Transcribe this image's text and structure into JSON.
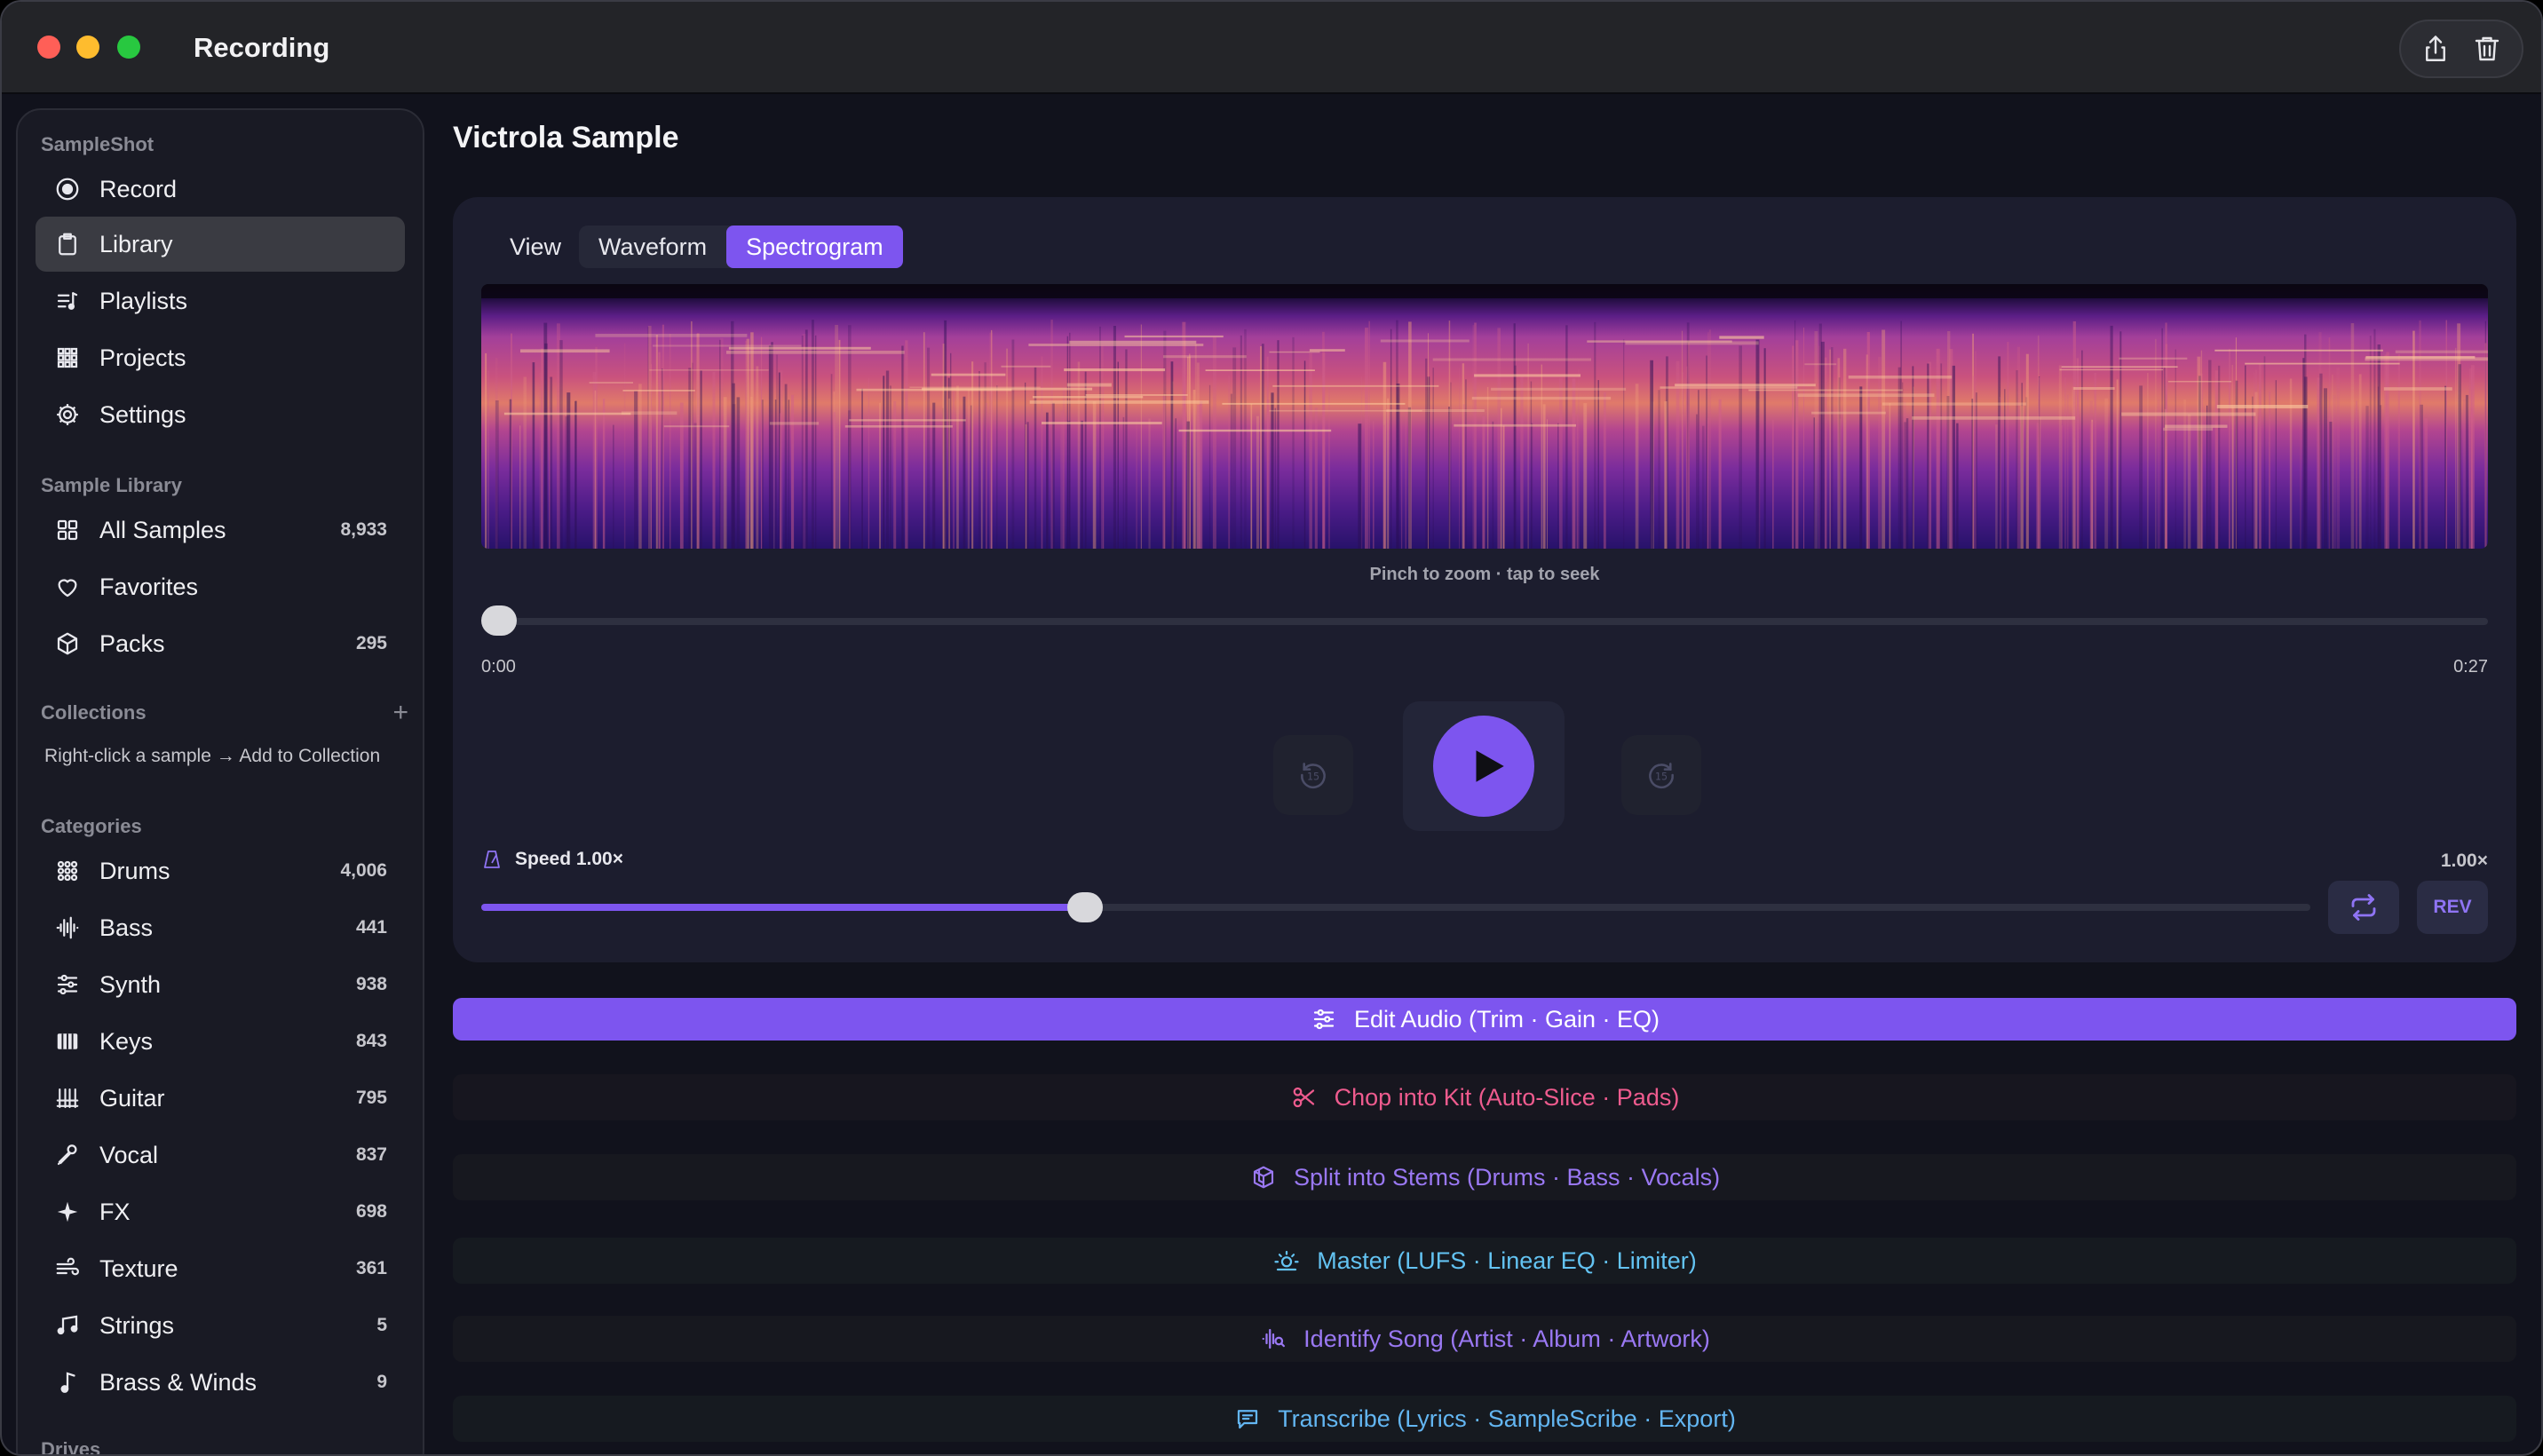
{
  "window": {
    "title": "Recording"
  },
  "sidebar": {
    "sections": {
      "app": "SampleShot",
      "library": "Sample Library",
      "collections": "Collections",
      "categories": "Categories",
      "drives": "Drives"
    },
    "app_items": [
      {
        "label": "Record",
        "icon": "record-icon"
      },
      {
        "label": "Library",
        "icon": "clipboard-icon",
        "active": true
      },
      {
        "label": "Playlists",
        "icon": "playlist-icon"
      },
      {
        "label": "Projects",
        "icon": "grid-icon"
      },
      {
        "label": "Settings",
        "icon": "gear-icon"
      }
    ],
    "library_items": [
      {
        "label": "All Samples",
        "count": "8,933",
        "icon": "squares-icon"
      },
      {
        "label": "Favorites",
        "count": "",
        "icon": "heart-icon"
      },
      {
        "label": "Packs",
        "count": "295",
        "icon": "box-icon"
      }
    ],
    "collections_add": "+",
    "collections_hint": "Right-click a sample → Add to Collection",
    "categories": [
      {
        "label": "Drums",
        "count": "4,006",
        "icon": "drum-pads-icon"
      },
      {
        "label": "Bass",
        "count": "441",
        "icon": "waveform-icon"
      },
      {
        "label": "Synth",
        "count": "938",
        "icon": "sliders-icon"
      },
      {
        "label": "Keys",
        "count": "843",
        "icon": "piano-icon"
      },
      {
        "label": "Guitar",
        "count": "795",
        "icon": "guitar-icon"
      },
      {
        "label": "Vocal",
        "count": "837",
        "icon": "microphone-icon"
      },
      {
        "label": "FX",
        "count": "698",
        "icon": "sparkle-icon"
      },
      {
        "label": "Texture",
        "count": "361",
        "icon": "wind-icon"
      },
      {
        "label": "Strings",
        "count": "5",
        "icon": "music-notes-icon"
      },
      {
        "label": "Brass & Winds",
        "count": "9",
        "icon": "music-note-icon"
      }
    ]
  },
  "main": {
    "title": "Victrola Sample",
    "view_label": "View",
    "view_options": [
      "Waveform",
      "Spectrogram"
    ],
    "view_selected": "Spectrogram",
    "zoom_hint": "Pinch to zoom · tap to seek",
    "time_start": "0:00",
    "time_end": "0:27",
    "playback_progress": 0,
    "speed_label": "Speed 1.00×",
    "speed_value": "1.00×",
    "speed_slider_fraction": 0.33,
    "rev_label": "REV"
  },
  "actions": [
    {
      "key": "edit",
      "label": "Edit Audio (Trim · Gain · EQ)",
      "icon": "sliders-icon"
    },
    {
      "key": "chop",
      "label": "Chop into Kit (Auto-Slice · Pads)",
      "icon": "scissors-icon"
    },
    {
      "key": "stems",
      "label": "Split into Stems (Drums · Bass · Vocals)",
      "icon": "cube-stack-icon"
    },
    {
      "key": "master",
      "label": "Master (LUFS · Linear EQ · Limiter)",
      "icon": "sun-icon"
    },
    {
      "key": "identify",
      "label": "Identify Song (Artist · Album · Artwork)",
      "icon": "waveform-search-icon"
    },
    {
      "key": "transcribe",
      "label": "Transcribe (Lyrics · SampleScribe · Export)",
      "icon": "chat-bubble-icon"
    }
  ],
  "colors": {
    "accent": "#7d55ef",
    "chop": "#ee5b8e",
    "stems": "#9a78f3",
    "master": "#63c3f2",
    "transcribe": "#63b6f2"
  }
}
